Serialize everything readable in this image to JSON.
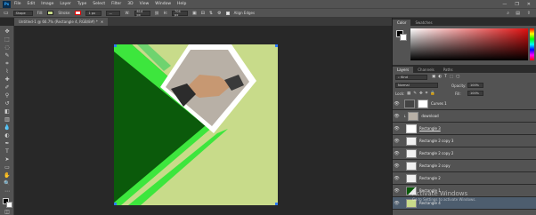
{
  "app": {
    "logo": "Ps"
  },
  "menu": [
    "File",
    "Edit",
    "Image",
    "Layer",
    "Type",
    "Select",
    "Filter",
    "3D",
    "View",
    "Window",
    "Help"
  ],
  "window_controls": [
    "—",
    "❐",
    "✕"
  ],
  "options": {
    "mode": "Shape",
    "fill_label": "Fill:",
    "stroke_label": "Stroke:",
    "stroke_size": "1 px",
    "w_label": "W:",
    "w_value": "614 px",
    "h_label": "H:",
    "h_value": "704 px",
    "align_edges": "Align Edges"
  },
  "document": {
    "tab_title": "Untitled-1 @ 66.7% (Rectangle 4, RGB/8#) *"
  },
  "panels": {
    "top_tabs": [
      "Color",
      "Swatches"
    ],
    "layer_tabs": [
      "Layers",
      "Channels",
      "Paths"
    ],
    "kind": "Kind",
    "blend_mode": "Normal",
    "opacity_label": "Opacity:",
    "opacity_value": "100%",
    "lock_label": "Lock:",
    "fill_label": "Fill:",
    "fill_value": "100%"
  },
  "layers": [
    {
      "name": "Curves 1",
      "eye": "👁",
      "selected": false
    },
    {
      "name": "download",
      "eye": "👁",
      "selected": false
    },
    {
      "name": "Rectangle 3",
      "eye": "👁",
      "selected": false
    },
    {
      "name": "Rectangle 2 copy 3",
      "eye": "👁",
      "selected": false
    },
    {
      "name": "Rectangle 2 copy 2",
      "eye": "👁",
      "selected": false
    },
    {
      "name": "Rectangle 2 copy",
      "eye": "👁",
      "selected": false
    },
    {
      "name": "Rectangle 2",
      "eye": "👁",
      "selected": false
    },
    {
      "name": "Rectangle 1",
      "eye": "👁",
      "selected": false
    },
    {
      "name": "Rectangle 4",
      "eye": "👁",
      "selected": true
    }
  ],
  "watermark": {
    "line1": "Activate Windows",
    "line2": "Go to Settings to activate Windows."
  },
  "colors": {
    "canvas_bg": "#c8db8a",
    "dark_green": "#0b5a0b",
    "bright_green": "#3de63d",
    "accent_green": "#6fd36f"
  }
}
